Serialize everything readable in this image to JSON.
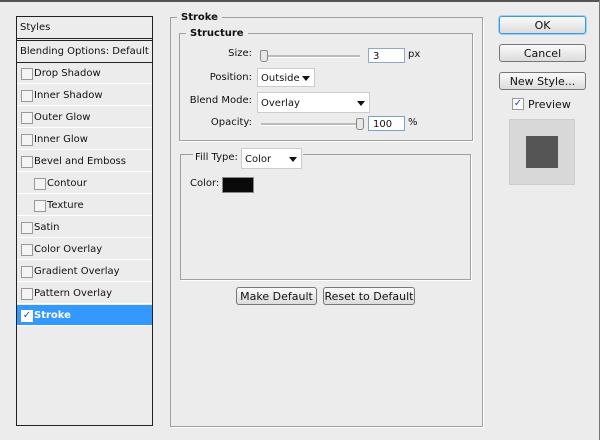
{
  "styles_panel": {
    "header": "Styles",
    "blending": "Blending Options: Default",
    "items": [
      {
        "label": "Drop Shadow",
        "checked": false
      },
      {
        "label": "Inner Shadow",
        "checked": false
      },
      {
        "label": "Outer Glow",
        "checked": false
      },
      {
        "label": "Inner Glow",
        "checked": false
      },
      {
        "label": "Bevel and Emboss",
        "checked": false
      },
      {
        "label": "Contour",
        "checked": false,
        "sub": true
      },
      {
        "label": "Texture",
        "checked": false,
        "sub": true
      },
      {
        "label": "Satin",
        "checked": false
      },
      {
        "label": "Color Overlay",
        "checked": false
      },
      {
        "label": "Gradient Overlay",
        "checked": false
      },
      {
        "label": "Pattern Overlay",
        "checked": false
      },
      {
        "label": "Stroke",
        "checked": true,
        "selected": true
      }
    ]
  },
  "stroke": {
    "title": "Stroke",
    "structure_title": "Structure",
    "size_label": "Size:",
    "size_value": "3",
    "size_unit": "px",
    "size_fraction": 0.01,
    "position_label": "Position:",
    "position_value": "Outside",
    "blend_label": "Blend Mode:",
    "blend_value": "Overlay",
    "opacity_label": "Opacity:",
    "opacity_value": "100",
    "opacity_unit": "%",
    "opacity_fraction": 1.0,
    "fill_type_label": "Fill Type:",
    "fill_type_value": "Color",
    "color_label": "Color:",
    "color_value": "#0a0a0a",
    "make_default": "Make Default",
    "reset_default": "Reset to Default"
  },
  "actions": {
    "ok": "OK",
    "cancel": "Cancel",
    "new_style": "New Style...",
    "preview_label": "Preview",
    "preview_checked": true,
    "accent": "#3399ff"
  }
}
